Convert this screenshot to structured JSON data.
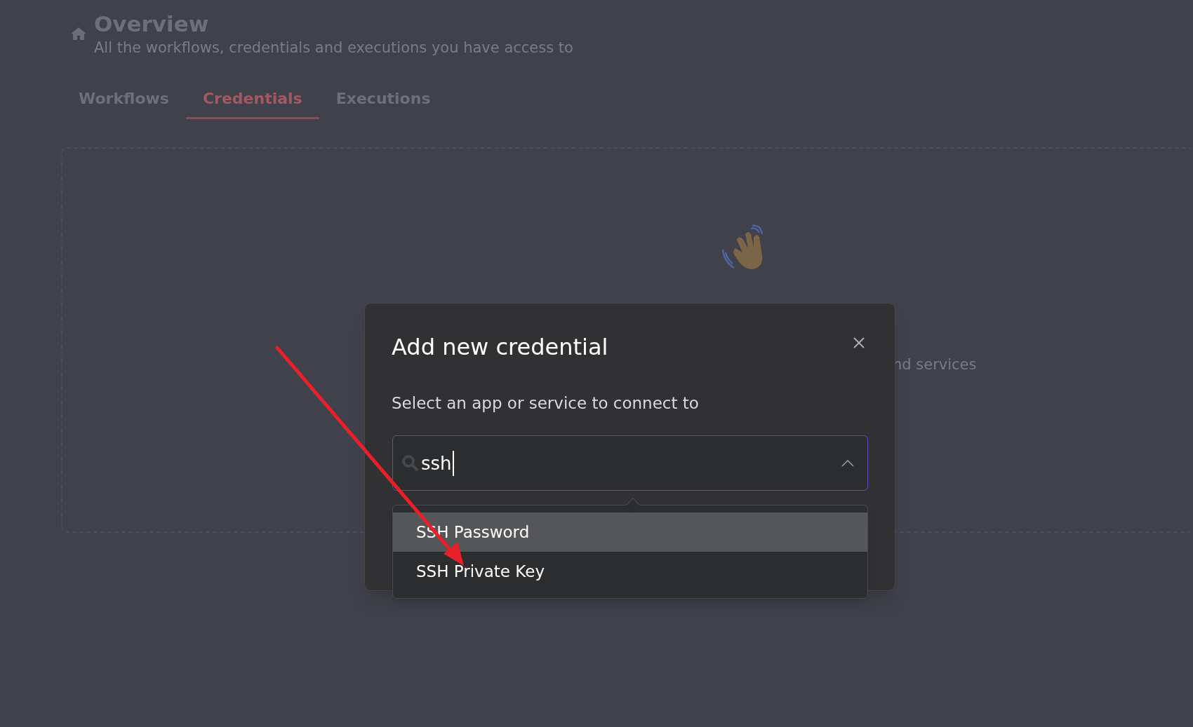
{
  "page": {
    "title": "Overview",
    "subtitle": "All the workflows, credentials and executions you have access to",
    "tabs": [
      {
        "label": "Workflows",
        "selected": false
      },
      {
        "label": "Credentials",
        "selected": true
      },
      {
        "label": "Executions",
        "selected": false
      }
    ]
  },
  "empty_state": {
    "text_fragment": "nd services"
  },
  "modal": {
    "title": "Add new credential",
    "prompt": "Select an app or service to connect to",
    "search": {
      "value": "ssh",
      "expanded": true
    },
    "options": [
      {
        "label": "SSH Password",
        "selected": true
      },
      {
        "label": "SSH Private Key",
        "selected": false
      }
    ]
  }
}
